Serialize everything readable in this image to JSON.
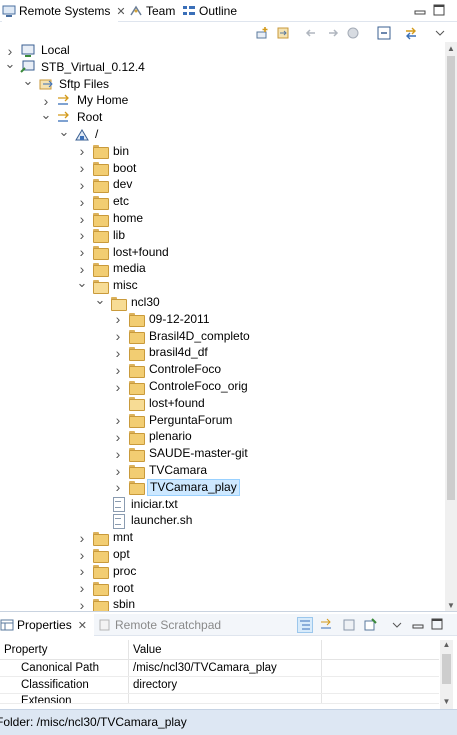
{
  "top_tabs": [
    {
      "label": "Remote Systems",
      "active": true,
      "close": "✕"
    },
    {
      "label": "Team",
      "active": false
    },
    {
      "label": "Outline",
      "active": false
    }
  ],
  "tree": [
    {
      "label": "Local",
      "level": 0,
      "twisty": "closed",
      "icon": "local-system-icon"
    },
    {
      "label": "STB_Virtual_0.12.4",
      "level": 0,
      "twisty": "open",
      "icon": "remote-system-icon"
    },
    {
      "label": "Sftp Files",
      "level": 1,
      "twisty": "open",
      "icon": "sftp-files-icon"
    },
    {
      "label": "My Home",
      "level": 2,
      "twisty": "closed",
      "icon": "filter-icon"
    },
    {
      "label": "Root",
      "level": 2,
      "twisty": "open",
      "icon": "filter-icon"
    },
    {
      "label": "/",
      "level": 3,
      "twisty": "open",
      "icon": "root-drive-icon"
    },
    {
      "label": "bin",
      "level": 4,
      "twisty": "closed",
      "icon": "folder-icon"
    },
    {
      "label": "boot",
      "level": 4,
      "twisty": "closed",
      "icon": "folder-icon"
    },
    {
      "label": "dev",
      "level": 4,
      "twisty": "closed",
      "icon": "folder-icon"
    },
    {
      "label": "etc",
      "level": 4,
      "twisty": "closed",
      "icon": "folder-icon"
    },
    {
      "label": "home",
      "level": 4,
      "twisty": "closed",
      "icon": "folder-icon"
    },
    {
      "label": "lib",
      "level": 4,
      "twisty": "closed",
      "icon": "folder-icon"
    },
    {
      "label": "lost+found",
      "level": 4,
      "twisty": "closed",
      "icon": "folder-icon"
    },
    {
      "label": "media",
      "level": 4,
      "twisty": "closed",
      "icon": "folder-icon"
    },
    {
      "label": "misc",
      "level": 4,
      "twisty": "open",
      "icon": "folder-open-icon"
    },
    {
      "label": "ncl30",
      "level": 5,
      "twisty": "open",
      "icon": "folder-open-icon"
    },
    {
      "label": "09-12-2011",
      "level": 6,
      "twisty": "closed",
      "icon": "folder-icon"
    },
    {
      "label": "Brasil4D_completo",
      "level": 6,
      "twisty": "closed",
      "icon": "folder-icon"
    },
    {
      "label": "brasil4d_df",
      "level": 6,
      "twisty": "closed",
      "icon": "folder-icon"
    },
    {
      "label": "ControleFoco",
      "level": 6,
      "twisty": "closed",
      "icon": "folder-icon"
    },
    {
      "label": "ControleFoco_orig",
      "level": 6,
      "twisty": "closed",
      "icon": "folder-icon"
    },
    {
      "label": "lost+found",
      "level": 6,
      "twisty": "none",
      "icon": "folder-open-icon"
    },
    {
      "label": "PerguntaForum",
      "level": 6,
      "twisty": "closed",
      "icon": "folder-icon"
    },
    {
      "label": "plenario",
      "level": 6,
      "twisty": "closed",
      "icon": "folder-icon"
    },
    {
      "label": "SAUDE-master-git",
      "level": 6,
      "twisty": "closed",
      "icon": "folder-icon"
    },
    {
      "label": "TVCamara",
      "level": 6,
      "twisty": "closed",
      "icon": "folder-icon"
    },
    {
      "label": "TVCamara_play",
      "level": 6,
      "twisty": "closed",
      "icon": "folder-icon",
      "selected": true
    },
    {
      "label": "iniciar.txt",
      "level": 5,
      "twisty": "none",
      "icon": "file-icon"
    },
    {
      "label": "launcher.sh",
      "level": 5,
      "twisty": "none",
      "icon": "file-icon"
    },
    {
      "label": "mnt",
      "level": 4,
      "twisty": "closed",
      "icon": "folder-icon"
    },
    {
      "label": "opt",
      "level": 4,
      "twisty": "closed",
      "icon": "folder-icon"
    },
    {
      "label": "proc",
      "level": 4,
      "twisty": "closed",
      "icon": "folder-icon"
    },
    {
      "label": "root",
      "level": 4,
      "twisty": "closed",
      "icon": "folder-icon"
    },
    {
      "label": "sbin",
      "level": 4,
      "twisty": "closed",
      "icon": "folder-icon"
    }
  ],
  "bottom_tabs": [
    {
      "label": "Properties",
      "active": true,
      "close": "✕"
    },
    {
      "label": "Remote Scratchpad",
      "active": false
    }
  ],
  "properties": {
    "headers": [
      "Property",
      "Value"
    ],
    "rows": [
      {
        "property": "Canonical Path",
        "value": "/misc/ncl30/TVCamara_play"
      },
      {
        "property": "Classification",
        "value": "directory"
      },
      {
        "property": "Extension",
        "value": ""
      }
    ]
  },
  "status": {
    "text": "Folder: /misc/ncl30/TVCamara_play"
  },
  "colors": {
    "selection_bg": "#cde8ff",
    "selection_border": "#99d1ff",
    "status_bg": "#dde7f3",
    "folder": "#f2cd72"
  }
}
